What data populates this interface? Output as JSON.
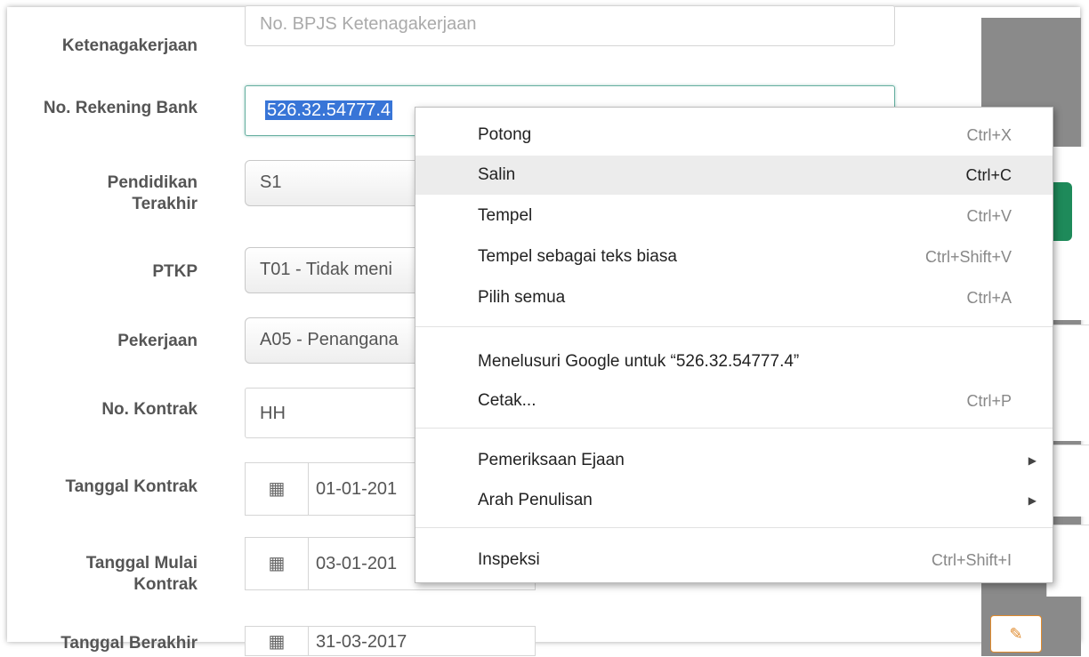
{
  "form": {
    "bpjs_label": "Ketenagakerjaan",
    "bpjs_placeholder": "No. BPJS Ketenagakerjaan",
    "rekening_label": "No. Rekening Bank",
    "rekening_value": "526.32.54777.4",
    "pendidikan_label_1": "Pendidikan",
    "pendidikan_label_2": "Terakhir",
    "pendidikan_value": "S1",
    "ptkp_label": "PTKP",
    "ptkp_value": "T01 - Tidak meni",
    "pekerjaan_label": "Pekerjaan",
    "pekerjaan_value": "A05 - Penangana",
    "kontrak_label": "No. Kontrak",
    "kontrak_value": "HH",
    "tgl_kontrak_label": "Tanggal Kontrak",
    "tgl_kontrak_value": "01-01-201",
    "tgl_mulai_label_1": "Tanggal Mulai",
    "tgl_mulai_label_2": "Kontrak",
    "tgl_mulai_value": "03-01-201",
    "tgl_berakhir_label": "Tanggal Berakhir",
    "tgl_berakhir_value": "31-03-2017",
    "calendar_icon": "calendar-icon"
  },
  "context_menu": {
    "items": [
      {
        "label": "Potong",
        "shortcut": "Ctrl+X"
      },
      {
        "label": "Salin",
        "shortcut": "Ctrl+C"
      },
      {
        "label": "Tempel",
        "shortcut": "Ctrl+V"
      },
      {
        "label": "Tempel sebagai teks biasa",
        "shortcut": "Ctrl+Shift+V"
      },
      {
        "label": "Pilih semua",
        "shortcut": "Ctrl+A"
      },
      {
        "label": "Menelusuri Google untuk “526.32.54777.4”",
        "shortcut": ""
      },
      {
        "label": "Cetak...",
        "shortcut": "Ctrl+P"
      },
      {
        "label": "Pemeriksaan Ejaan",
        "shortcut": ""
      },
      {
        "label": "Arah Penulisan",
        "shortcut": ""
      },
      {
        "label": "Inspeksi",
        "shortcut": "Ctrl+Shift+I"
      }
    ],
    "highlighted": "Salin"
  },
  "colors": {
    "accent": "#3875d7",
    "panel": "#8a8a8a",
    "button_green": "#1e8a5a",
    "edit_orange": "#e08a2c"
  }
}
